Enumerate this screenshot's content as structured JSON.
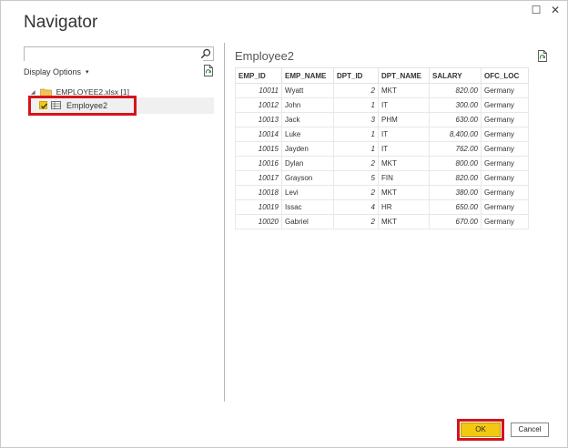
{
  "window": {
    "title": "Navigator",
    "minimize_glyph": "☐",
    "close_glyph": "✕"
  },
  "search": {
    "value": "",
    "placeholder": "",
    "icon": "search-icon"
  },
  "display_options": {
    "label": "Display Options",
    "caret": "▾"
  },
  "tree": {
    "file": {
      "label": "EMPLOYEE2.xlsx [1]",
      "toggle": "◢",
      "icon": "folder-icon"
    },
    "items": [
      {
        "label": "Employee2",
        "checked": true,
        "icon": "table-icon"
      }
    ]
  },
  "preview": {
    "title": "Employee2",
    "columns": [
      "EMP_ID",
      "EMP_NAME",
      "DPT_ID",
      "DPT_NAME",
      "SALARY",
      "OFC_LOC"
    ],
    "rows": [
      [
        "10011",
        "Wyatt",
        "2",
        "MKT",
        "820.00",
        "Germany"
      ],
      [
        "10012",
        "John",
        "1",
        "IT",
        "300.00",
        "Germany"
      ],
      [
        "10013",
        "Jack",
        "3",
        "PHM",
        "630.00",
        "Germany"
      ],
      [
        "10014",
        "Luke",
        "1",
        "IT",
        "8,400.00",
        "Germany"
      ],
      [
        "10015",
        "Jayden",
        "1",
        "IT",
        "762.00",
        "Germany"
      ],
      [
        "10016",
        "Dylan",
        "2",
        "MKT",
        "800.00",
        "Germany"
      ],
      [
        "10017",
        "Grayson",
        "5",
        "FIN",
        "820.00",
        "Germany"
      ],
      [
        "10018",
        "Levi",
        "2",
        "MKT",
        "380.00",
        "Germany"
      ],
      [
        "10019",
        "Issac",
        "4",
        "HR",
        "650.00",
        "Germany"
      ],
      [
        "10020",
        "Gabriel",
        "2",
        "MKT",
        "670.00",
        "Germany"
      ]
    ]
  },
  "buttons": {
    "ok": "OK",
    "cancel": "Cancel"
  },
  "colors": {
    "accent": "#f3c811",
    "highlight": "#d4141c"
  }
}
